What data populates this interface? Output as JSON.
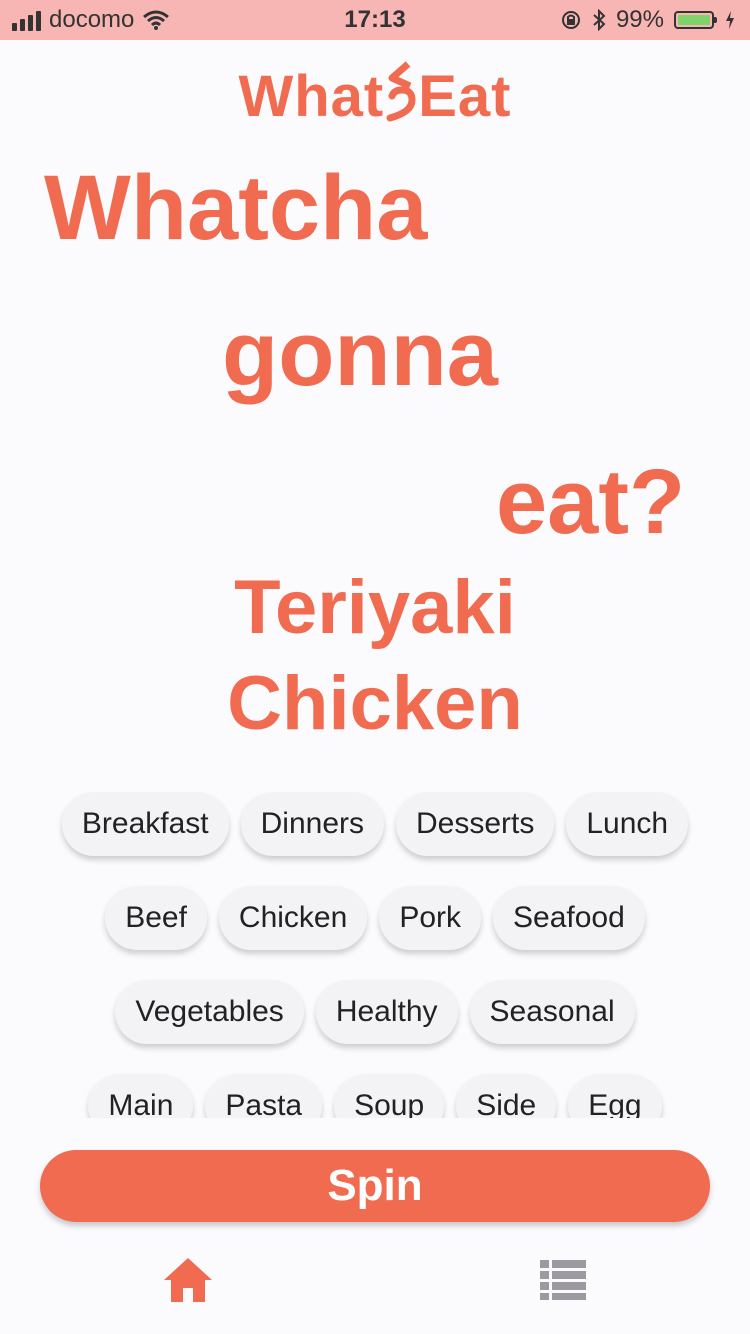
{
  "status_bar": {
    "carrier": "docomo",
    "time": "17:13",
    "battery_percent": "99%",
    "battery_level": 0.99,
    "icons": [
      "signal-icon",
      "wifi-icon",
      "orientation-lock-icon",
      "bluetooth-icon",
      "battery-icon",
      "charging-icon"
    ]
  },
  "app": {
    "logo_text_left": "What",
    "logo_text_right": "Eat"
  },
  "headline": {
    "line1": "Whatcha",
    "line2": "gonna",
    "line3": "eat?"
  },
  "result": {
    "line1": "Teriyaki",
    "line2": "Chicken"
  },
  "categories": {
    "row1": [
      "Breakfast",
      "Dinners",
      "Desserts",
      "Lunch"
    ],
    "row2": [
      "Beef",
      "Chicken",
      "Pork",
      "Seafood"
    ],
    "row3": [
      "Vegetables",
      "Healthy",
      "Seasonal"
    ],
    "row4": [
      "Main",
      "Pasta",
      "Soup",
      "Side",
      "Egg"
    ]
  },
  "spin_button": {
    "label": "Spin"
  },
  "tab_bar": {
    "items": [
      "home-icon",
      "list-icon"
    ],
    "active": "home",
    "active_color": "#f06b4f",
    "inactive_color": "#9a9aa0"
  },
  "colors": {
    "accent": "#f06b4f",
    "status_bar": "#f7b6b3",
    "background": "#fbfbfe"
  }
}
